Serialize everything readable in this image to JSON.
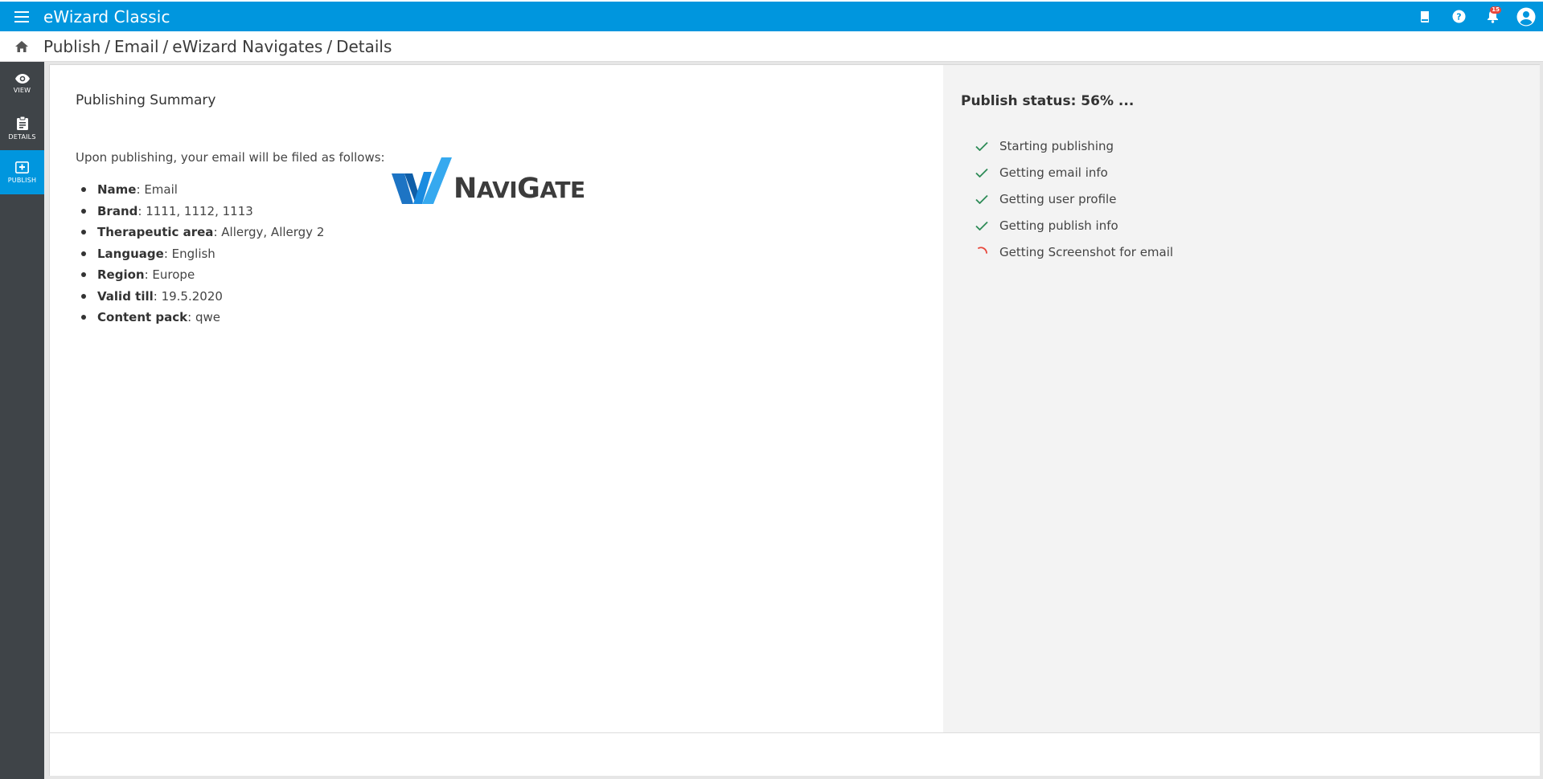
{
  "app": {
    "title": "eWizard Classic"
  },
  "topbar": {
    "icons": [
      "book-icon",
      "help-icon",
      "bell-icon",
      "account-icon"
    ],
    "notification_count": "15"
  },
  "breadcrumb": {
    "home_icon": "home-icon",
    "items": [
      "Publish",
      "Email",
      "eWizard Navigates",
      "Details"
    ],
    "separator": "/"
  },
  "rail": {
    "items": [
      {
        "label": "VIEW",
        "icon": "eye-icon",
        "active": false
      },
      {
        "label": "DETAILS",
        "icon": "clipboard-icon",
        "active": false
      },
      {
        "label": "PUBLISH",
        "icon": "publish-icon",
        "active": true
      }
    ]
  },
  "summary": {
    "title": "Publishing Summary",
    "intro": "Upon publishing, your email will be filed as follows:",
    "fields": [
      {
        "key": "Name",
        "value": "Email"
      },
      {
        "key": "Brand",
        "value": "1111, 1112, 1113"
      },
      {
        "key": "Therapeutic area",
        "value": "Allergy, Allergy 2"
      },
      {
        "key": "Language",
        "value": "English"
      },
      {
        "key": "Region",
        "value": "Europe"
      },
      {
        "key": "Valid till",
        "value": "19.5.2020"
      },
      {
        "key": "Content pack",
        "value": "qwe"
      }
    ],
    "logo": {
      "text_big_1": "N",
      "text_small_1": "AVI",
      "text_big_2": "G",
      "text_small_2": "ATE"
    }
  },
  "status": {
    "title": "Publish status: 56% ...",
    "progress_percent": 56,
    "steps": [
      {
        "label": "Starting publishing",
        "state": "done"
      },
      {
        "label": "Getting email info",
        "state": "done"
      },
      {
        "label": "Getting user profile",
        "state": "done"
      },
      {
        "label": "Getting publish info",
        "state": "done"
      },
      {
        "label": "Getting Screenshot for email",
        "state": "in-progress"
      }
    ]
  },
  "colors": {
    "primary": "#0096de",
    "rail": "#3f4448",
    "check": "#2e8b57",
    "spinner": "#e8473b"
  }
}
